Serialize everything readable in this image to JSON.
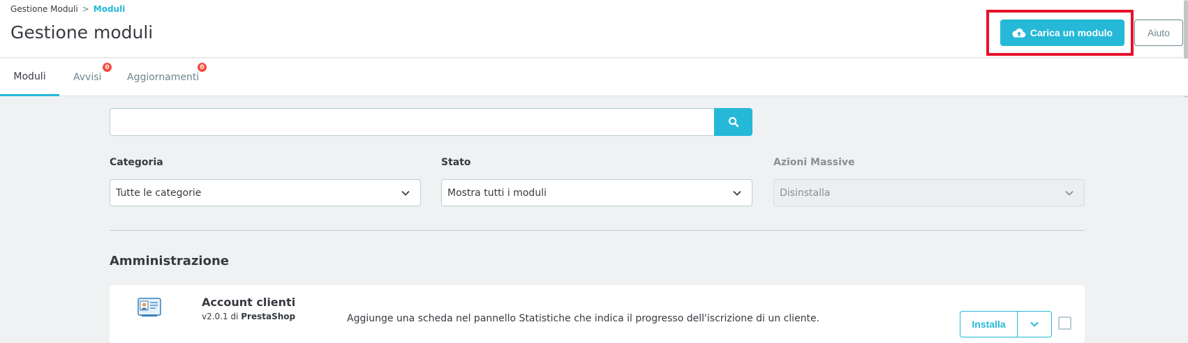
{
  "breadcrumb": {
    "parent": "Gestione Moduli",
    "separator": ">",
    "current": "Moduli"
  },
  "page_title": "Gestione moduli",
  "toolbar": {
    "upload_label": "Carica un modulo",
    "help_label": "Aiuto"
  },
  "tabs": [
    {
      "label": "Moduli",
      "active": true
    },
    {
      "label": "Avvisi",
      "badge": "0"
    },
    {
      "label": "Aggiornamenti",
      "badge": "0"
    }
  ],
  "search": {
    "value": "",
    "placeholder": ""
  },
  "filters": {
    "category": {
      "label": "Categoria",
      "value": "Tutte le categorie"
    },
    "status": {
      "label": "Stato",
      "value": "Mostra tutti i moduli"
    },
    "bulk": {
      "label": "Azioni Massive",
      "value": "Disinstalla",
      "disabled": true
    }
  },
  "section": {
    "title": "Amministrazione"
  },
  "module": {
    "name": "Account clienti",
    "version": "v2.0.1",
    "by": "di",
    "author": "PrestaShop",
    "description": "Aggiunge una scheda nel pannello Statistiche che indica il progresso dell'iscrizione di un cliente.",
    "install_label": "Installa"
  },
  "colors": {
    "primary": "#25b9d7",
    "highlight": "#e8102a",
    "badge": "#f54c3e"
  }
}
